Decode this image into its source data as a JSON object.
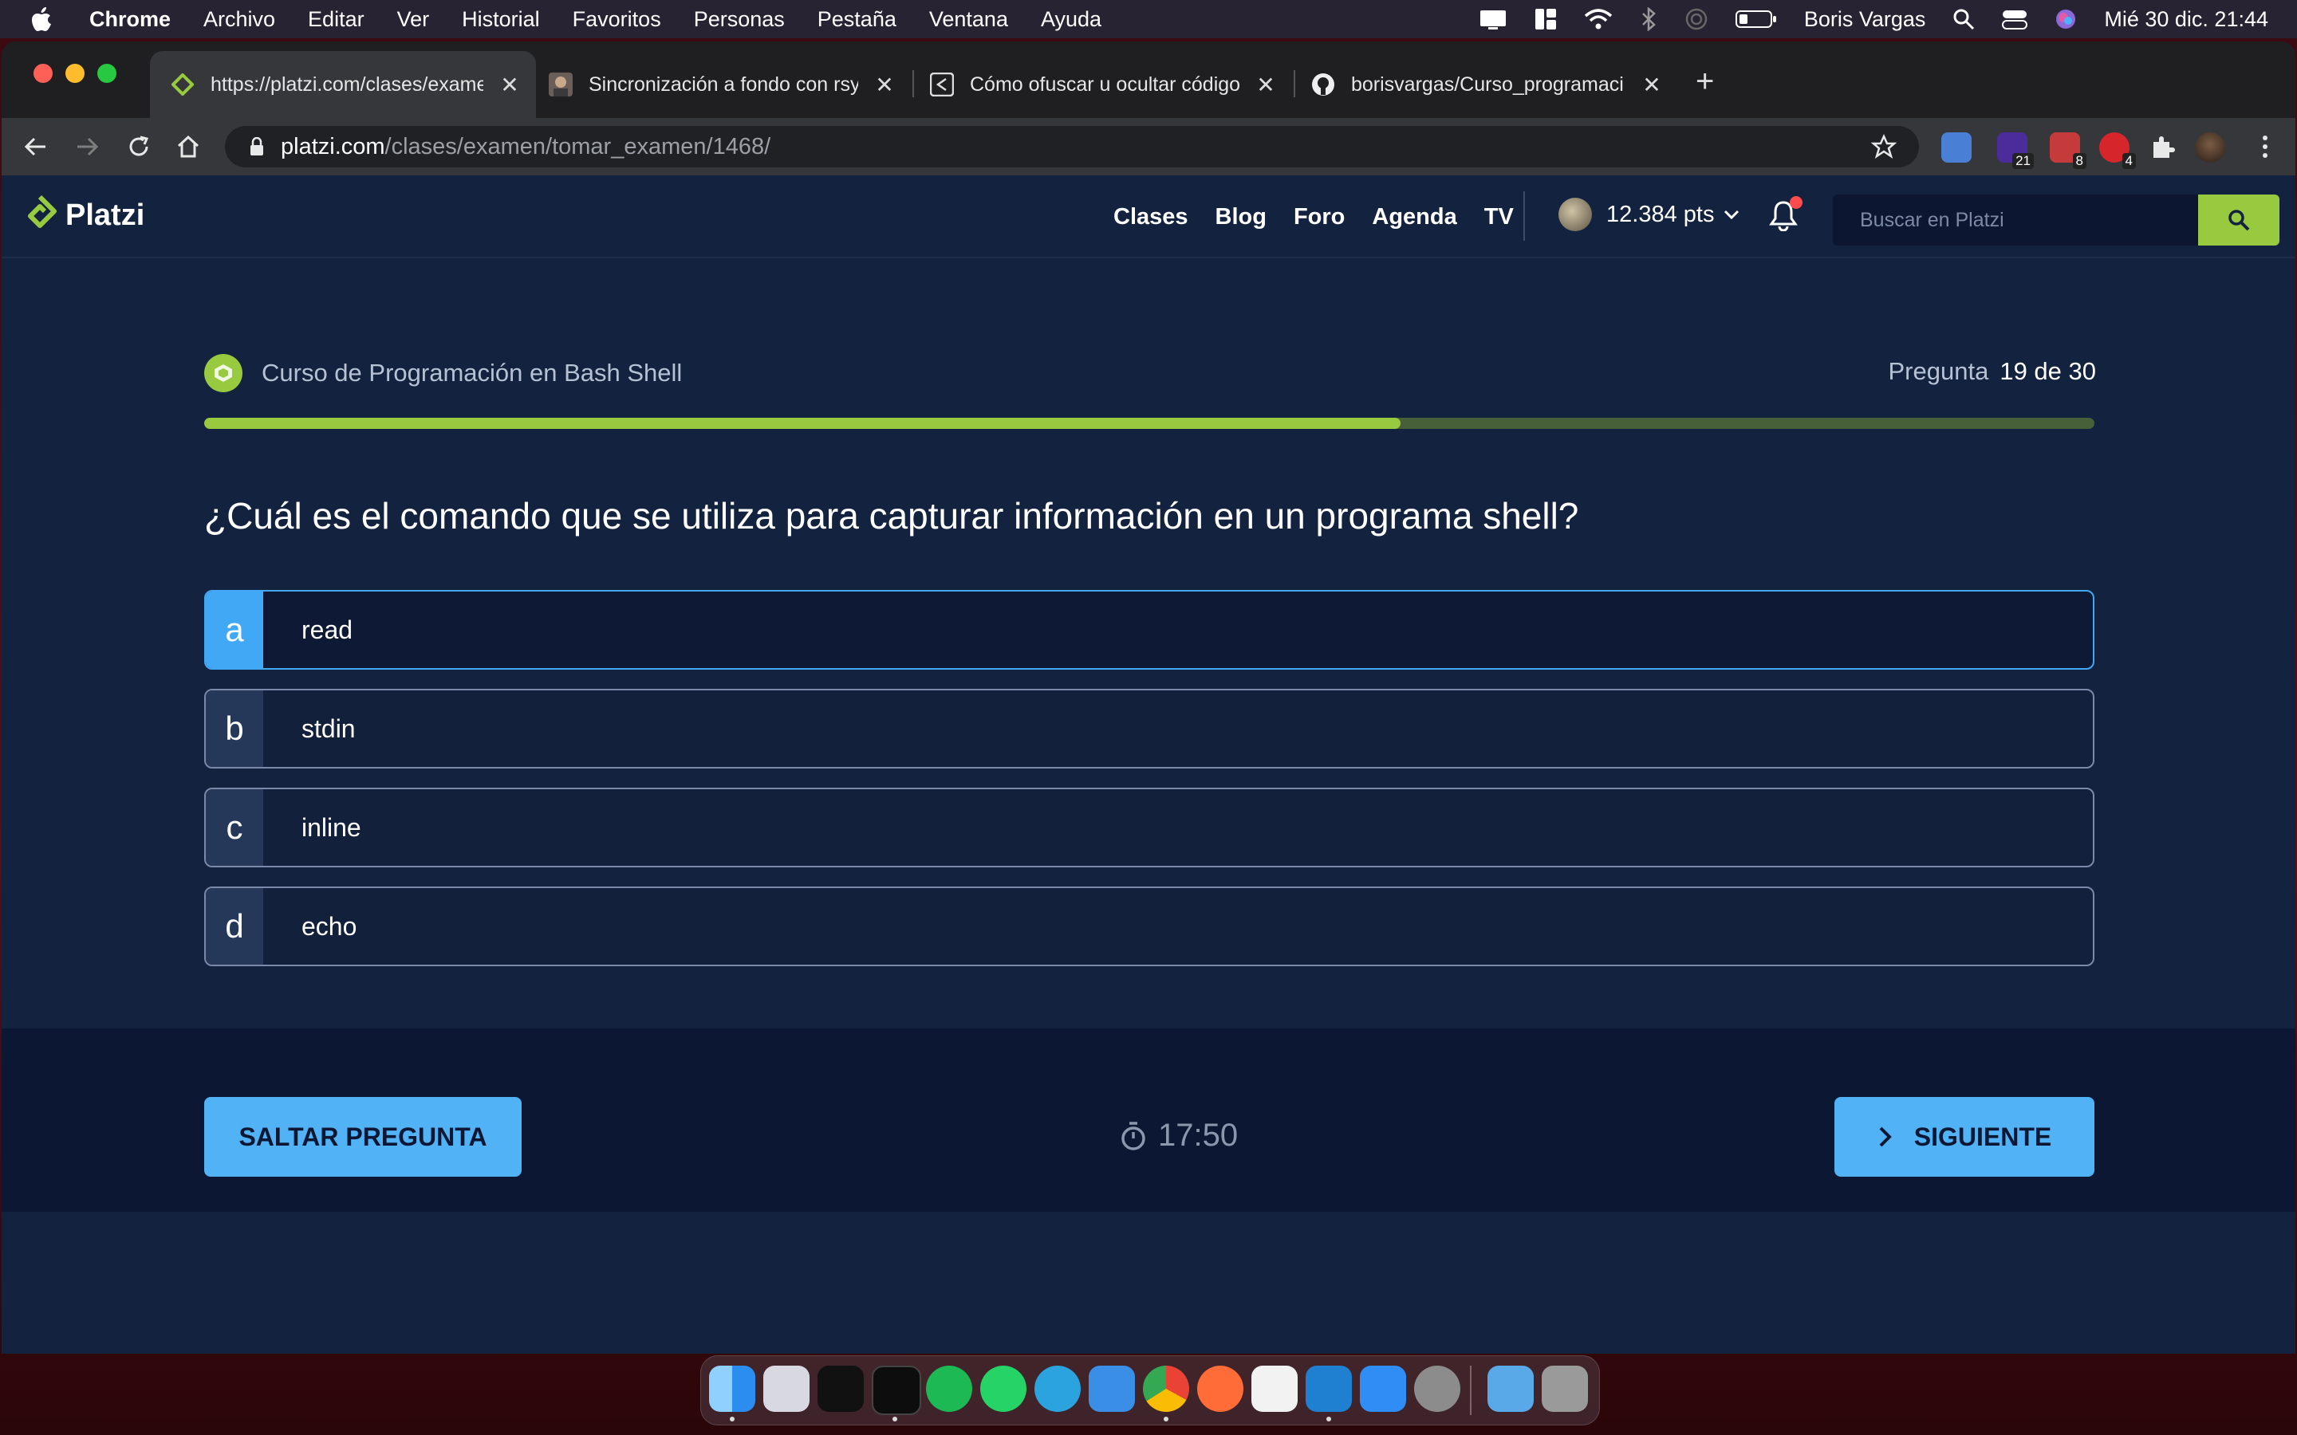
{
  "menubar": {
    "app_name": "Chrome",
    "items": [
      "Archivo",
      "Editar",
      "Ver",
      "Historial",
      "Favoritos",
      "Personas",
      "Pestaña",
      "Ventana",
      "Ayuda"
    ],
    "user": "Boris Vargas",
    "datetime": "Mié 30 dic.  21:44"
  },
  "browser": {
    "tabs": [
      {
        "title": "https://platzi.com/clases/exame",
        "icon": "platzi-icon",
        "active": true
      },
      {
        "title": "Sincronización a fondo con rsy",
        "icon": "avatar-icon",
        "active": false
      },
      {
        "title": "Cómo ofuscar u ocultar código",
        "icon": "share-icon",
        "active": false
      },
      {
        "title": "borisvargas/Curso_programaci",
        "icon": "github-icon",
        "active": false
      }
    ],
    "url_host": "platzi.com",
    "url_path": "/clases/examen/tomar_examen/1468/",
    "extensions": [
      {
        "name": "translate-icon",
        "badge": ""
      },
      {
        "name": "extension-purple-icon",
        "badge": "21"
      },
      {
        "name": "extension-red-icon",
        "badge": "8"
      },
      {
        "name": "extension-shield-icon",
        "badge": "4"
      },
      {
        "name": "puzzle-icon",
        "badge": ""
      }
    ]
  },
  "site": {
    "logo": "Platzi",
    "nav": [
      "Clases",
      "Blog",
      "Foro",
      "Agenda",
      "TV"
    ],
    "points": "12.384 pts",
    "search_placeholder": "Buscar en Platzi"
  },
  "exam": {
    "course": "Curso de Programación en Bash Shell",
    "question_label": "Pregunta",
    "question_count": "19 de 30",
    "progress": 0.633,
    "question": "¿Cuál es el comando que se utiliza para capturar información en un programa shell?",
    "options": [
      {
        "letter": "a",
        "text": "read"
      },
      {
        "letter": "b",
        "text": "stdin"
      },
      {
        "letter": "c",
        "text": "inline"
      },
      {
        "letter": "d",
        "text": "echo"
      }
    ],
    "selected_index": 0,
    "skip_label": "SALTAR PREGUNTA",
    "next_label": "SIGUIENTE",
    "timer": "17:50"
  },
  "dock": {
    "apps": [
      "finder-icon",
      "launchpad-icon",
      "terminal-icon",
      "iterm-icon",
      "spotify-icon",
      "whatsapp-icon",
      "telegram-icon",
      "safari-icon",
      "chrome-icon",
      "postman-icon",
      "sublime-icon",
      "vscode-icon",
      "appstore-icon",
      "settings-icon",
      "downloads-folder-icon",
      "trash-icon"
    ],
    "colors": {
      "accent": "#98ca3f",
      "primary_blue": "#51b2f6",
      "page_bg": "#13233f"
    }
  }
}
